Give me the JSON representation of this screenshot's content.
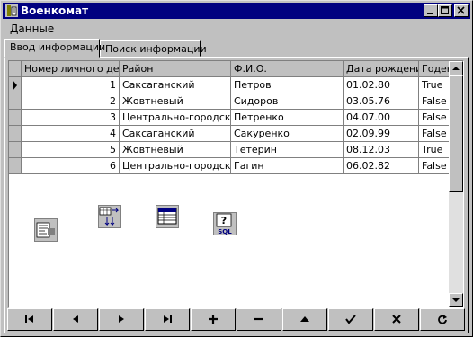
{
  "window": {
    "title": "Военкомат",
    "accent": "#000080"
  },
  "menu": {
    "items": [
      {
        "label": "Данные"
      }
    ]
  },
  "tabs": [
    {
      "label": "Ввод информации",
      "active": true
    },
    {
      "label": "Поиск информации",
      "active": false
    }
  ],
  "grid": {
    "columns": [
      "Номер личного дела",
      "Район",
      "Ф.И.О.",
      "Дата рождения",
      "Годен"
    ],
    "rows": [
      [
        "1",
        "Саксаганский",
        "Петров",
        "01.02.80",
        "True"
      ],
      [
        "2",
        "Жовтневый",
        "Сидоров",
        "03.05.76",
        "False"
      ],
      [
        "3",
        "Центрально-городской",
        "Петренко",
        "04.07.00",
        "False"
      ],
      [
        "4",
        "Саксаганский",
        "Сакуренко",
        "02.09.99",
        "False"
      ],
      [
        "5",
        "Жовтневый",
        "Тетерин",
        "08.12.03",
        "True"
      ],
      [
        "6",
        "Центрально-городской",
        "Гагин",
        "06.02.82",
        "False"
      ]
    ],
    "current_row": 0
  },
  "components": [
    {
      "icon": "datasource-icon"
    },
    {
      "icon": "batchmove-icon"
    },
    {
      "icon": "table-icon"
    },
    {
      "icon": "sql-query-icon",
      "label": "SQL"
    }
  ],
  "navigator": {
    "buttons": [
      {
        "icon": "first-record-icon"
      },
      {
        "icon": "prior-record-icon"
      },
      {
        "icon": "next-record-icon"
      },
      {
        "icon": "last-record-icon"
      },
      {
        "icon": "insert-record-icon"
      },
      {
        "icon": "delete-record-icon"
      },
      {
        "icon": "edit-record-icon"
      },
      {
        "icon": "post-edit-icon"
      },
      {
        "icon": "cancel-edit-icon"
      },
      {
        "icon": "refresh-data-icon"
      }
    ]
  }
}
